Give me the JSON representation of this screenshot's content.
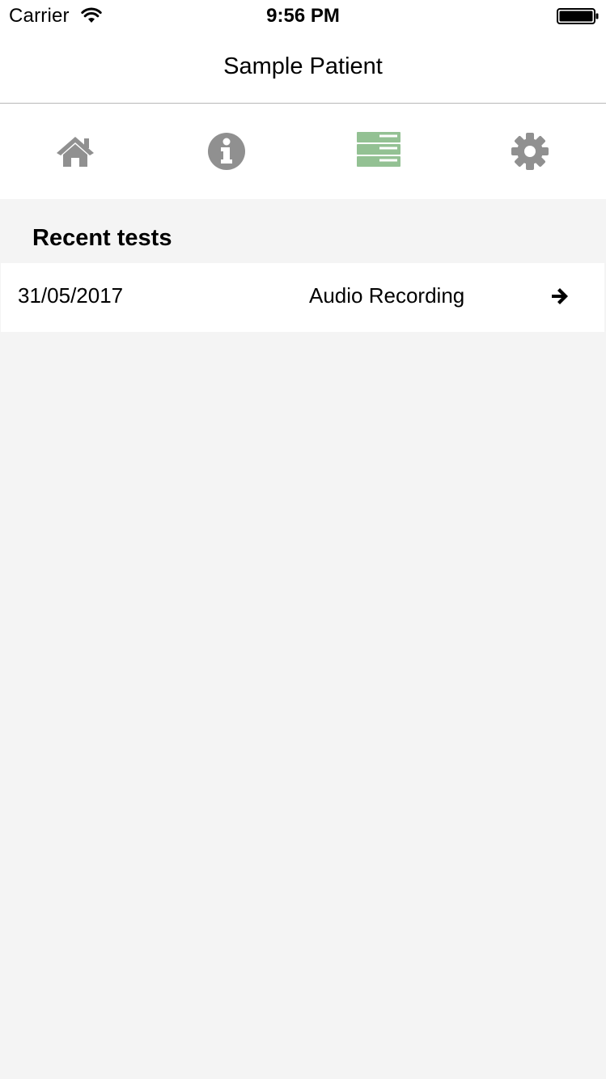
{
  "status_bar": {
    "carrier": "Carrier",
    "time": "9:56 PM",
    "wifi_icon": "wifi-icon",
    "battery_icon": "battery-full-icon"
  },
  "nav": {
    "title": "Sample Patient"
  },
  "tabs": [
    {
      "icon": "home-icon",
      "active": false
    },
    {
      "icon": "info-icon",
      "active": false
    },
    {
      "icon": "list-icon",
      "active": true
    },
    {
      "icon": "gear-icon",
      "active": false
    }
  ],
  "colors": {
    "active_tab": "#93c193",
    "inactive_tab": "#909090",
    "background": "#f4f4f4",
    "surface": "#ffffff"
  },
  "recent": {
    "title": "Recent tests",
    "items": [
      {
        "date": "31/05/2017",
        "type": "Audio Recording",
        "action_icon": "arrow-right-icon"
      }
    ]
  }
}
